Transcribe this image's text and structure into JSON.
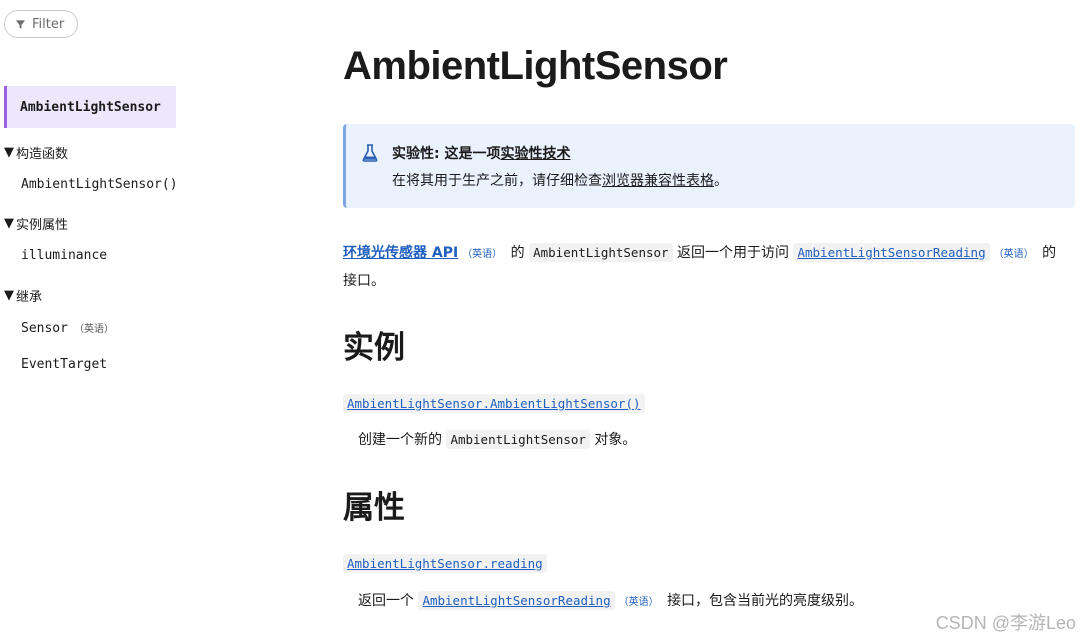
{
  "sidebar": {
    "filter_label": "Filter",
    "active_item": "AmbientLightSensor",
    "groups": [
      {
        "label": "构造函数",
        "items": [
          "AmbientLightSensor()"
        ]
      },
      {
        "label": "实例属性",
        "items": [
          "illuminance"
        ]
      },
      {
        "label": "继承",
        "items": [
          "Sensor",
          "EventTarget"
        ]
      }
    ],
    "english_tag": "（英语）"
  },
  "main": {
    "title": "AmbientLightSensor",
    "notice": {
      "prefix": "实验性: 这是一项",
      "link": "实验性技术",
      "line2_prefix": "在将其用于生产之前，请仔细检查",
      "line2_link": "浏览器兼容性表格",
      "line2_suffix": "。"
    },
    "intro": {
      "api_link": "环境光传感器 API",
      "tag": "（英语）",
      "text1": "的",
      "code": "AmbientLightSensor",
      "text2": "返回一个用于访问",
      "reading_link": "AmbientLightSensorReading",
      "tag2": "（英语）",
      "text3": "的",
      "text4": "接口。"
    },
    "section_constructor": {
      "heading": "实例",
      "term": "AmbientLightSensor.AmbientLightSensor()",
      "desc_prefix": "创建一个新的",
      "desc_code": "AmbientLightSensor",
      "desc_suffix": "对象。"
    },
    "section_properties": {
      "heading": "属性",
      "term": "AmbientLightSensor.reading",
      "desc_prefix": "返回一个",
      "desc_link": "AmbientLightSensorReading",
      "desc_tag": "（英语）",
      "desc_suffix": "接口，包含当前光的亮度级别。"
    }
  },
  "watermark": "CSDN @李游Leo",
  "colors": {
    "link": "#1f5fbf",
    "accent": "#9b5fe0",
    "notice_bg": "#eaf2fd"
  }
}
